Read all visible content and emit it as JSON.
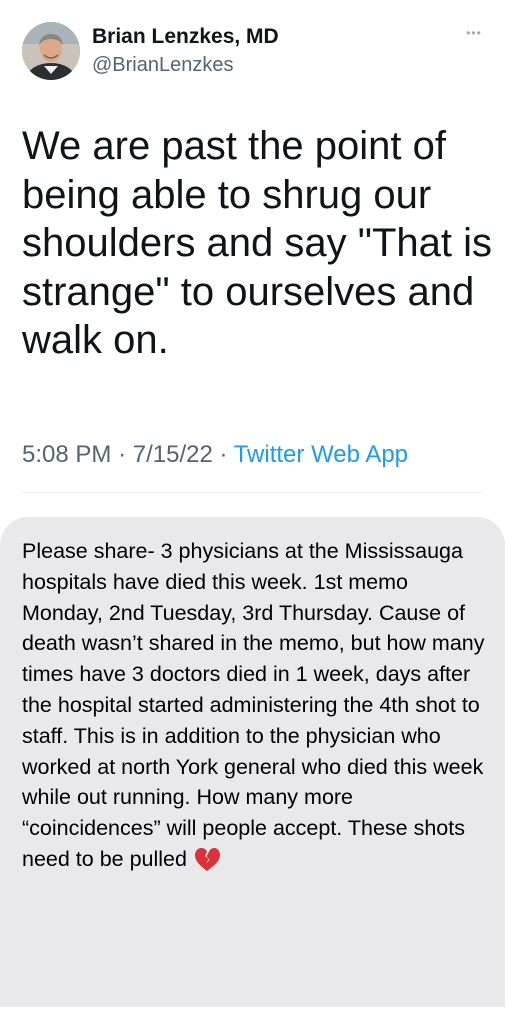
{
  "author": {
    "display_name": "Brian Lenzkes, MD",
    "handle": "@BrianLenzkes"
  },
  "tweet": {
    "text": "We are past the point of being able to shrug our shoulders and say \"That is strange\" to ourselves and walk on.",
    "time": "5:08 PM",
    "date": "7/15/22",
    "separator": "·",
    "source": "Twitter Web App"
  },
  "screenshot_message": {
    "text": "Please share- 3 physicians at the Mississauga hospitals have died this week. 1st memo Monday, 2nd Tuesday, 3rd Thursday. Cause of death wasn’t shared in the memo, but how many times have 3 doctors died in 1 week, days after the hospital started administering the 4th shot to staff. This is in addition to the physician who worked at north York general who died this week while out running. How many more “coincidences” will people accept. These shots need to be pulled",
    "emoji": "broken-heart-icon"
  },
  "icons": {
    "more": "more-horizontal-icon",
    "avatar": "profile-avatar"
  },
  "colors": {
    "link": "#1d9bf0",
    "secondary_text": "#536471",
    "bubble_background": "#e9e9eb",
    "emoji_red": "#d9323a"
  }
}
